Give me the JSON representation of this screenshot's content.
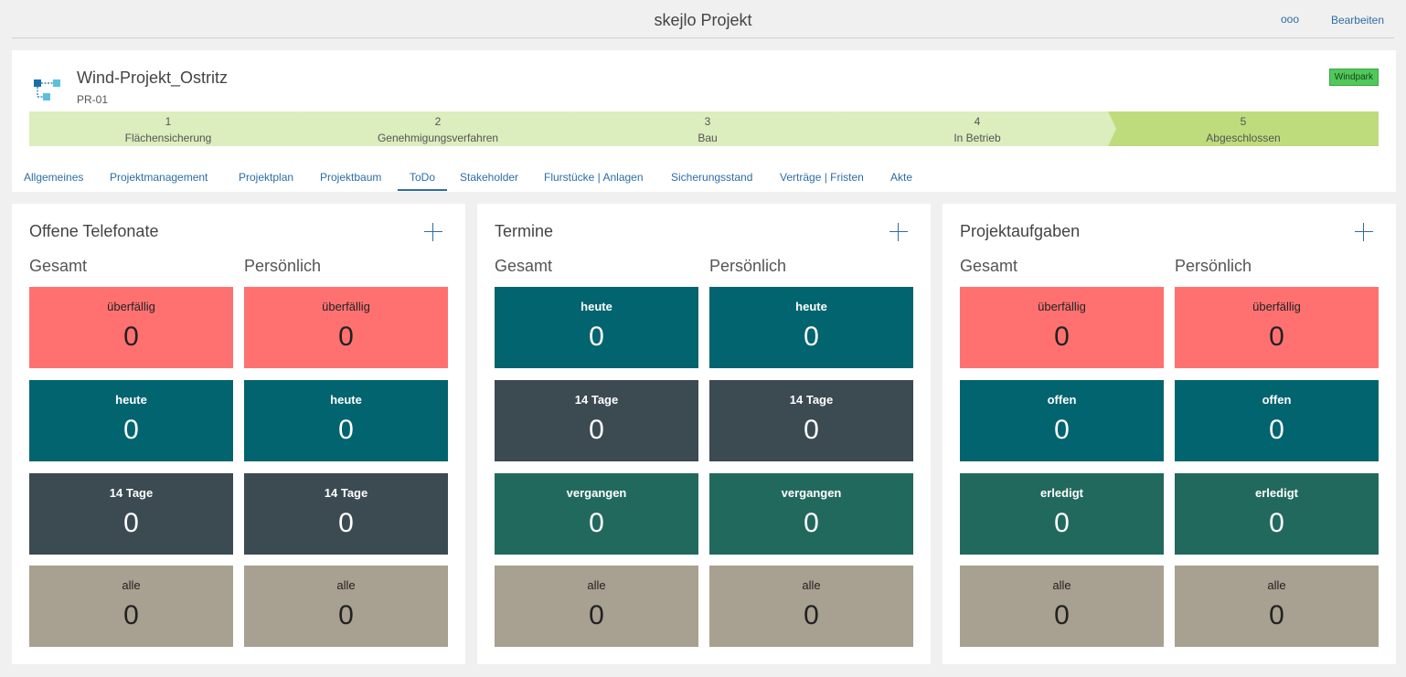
{
  "topbar": {
    "title": "skejlo Projekt",
    "more_label": "ooo",
    "edit_label": "Bearbeiten"
  },
  "project": {
    "name": "Wind-Projekt_Ostritz",
    "code": "PR-01",
    "badge": "Windpark"
  },
  "steps": [
    {
      "num": "1",
      "label": "Flächensicherung"
    },
    {
      "num": "2",
      "label": "Genehmigungsverfahren"
    },
    {
      "num": "3",
      "label": "Bau"
    },
    {
      "num": "4",
      "label": "In Betrieb"
    },
    {
      "num": "5",
      "label": "Abgeschlossen",
      "current": true
    }
  ],
  "tabs": [
    "Allgemeines",
    "Projektmanagement",
    "Projektplan",
    "Projektbaum",
    "ToDo",
    "Stakeholder",
    "Flurstücke | Anlagen",
    "Sicherungsstand",
    "Verträge | Fristen",
    "Akte"
  ],
  "active_tab": "ToDo",
  "panels": [
    {
      "title": "Offene Telefonate",
      "col_total": "Gesamt",
      "col_personal": "Persönlich",
      "total": [
        {
          "label": "überfällig",
          "value": "0"
        },
        {
          "label": "heute",
          "value": "0"
        },
        {
          "label": "14 Tage",
          "value": "0"
        },
        {
          "label": "alle",
          "value": "0"
        }
      ],
      "personal": [
        {
          "label": "überfällig",
          "value": "0"
        },
        {
          "label": "heute",
          "value": "0"
        },
        {
          "label": "14 Tage",
          "value": "0"
        },
        {
          "label": "alle",
          "value": "0"
        }
      ]
    },
    {
      "title": "Termine",
      "col_total": "Gesamt",
      "col_personal": "Persönlich",
      "total": [
        {
          "label": "heute",
          "value": "0"
        },
        {
          "label": "14 Tage",
          "value": "0"
        },
        {
          "label": "vergangen",
          "value": "0"
        },
        {
          "label": "alle",
          "value": "0"
        }
      ],
      "personal": [
        {
          "label": "heute",
          "value": "0"
        },
        {
          "label": "14 Tage",
          "value": "0"
        },
        {
          "label": "vergangen",
          "value": "0"
        },
        {
          "label": "alle",
          "value": "0"
        }
      ]
    },
    {
      "title": "Projektaufgaben",
      "col_total": "Gesamt",
      "col_personal": "Persönlich",
      "total": [
        {
          "label": "überfällig",
          "value": "0"
        },
        {
          "label": "offen",
          "value": "0"
        },
        {
          "label": "erledigt",
          "value": "0"
        },
        {
          "label": "alle",
          "value": "0"
        }
      ],
      "personal": [
        {
          "label": "überfällig",
          "value": "0"
        },
        {
          "label": "offen",
          "value": "0"
        },
        {
          "label": "erledigt",
          "value": "0"
        },
        {
          "label": "alle",
          "value": "0"
        }
      ]
    }
  ],
  "colors": {
    "overdue": "#ff7171",
    "teal": "#02646f",
    "slate": "#3c4a52",
    "green": "#22695d",
    "beige": "#a8a090",
    "step": "#dcedbe",
    "step_current": "#bedc7c",
    "link": "#2e6da4"
  }
}
